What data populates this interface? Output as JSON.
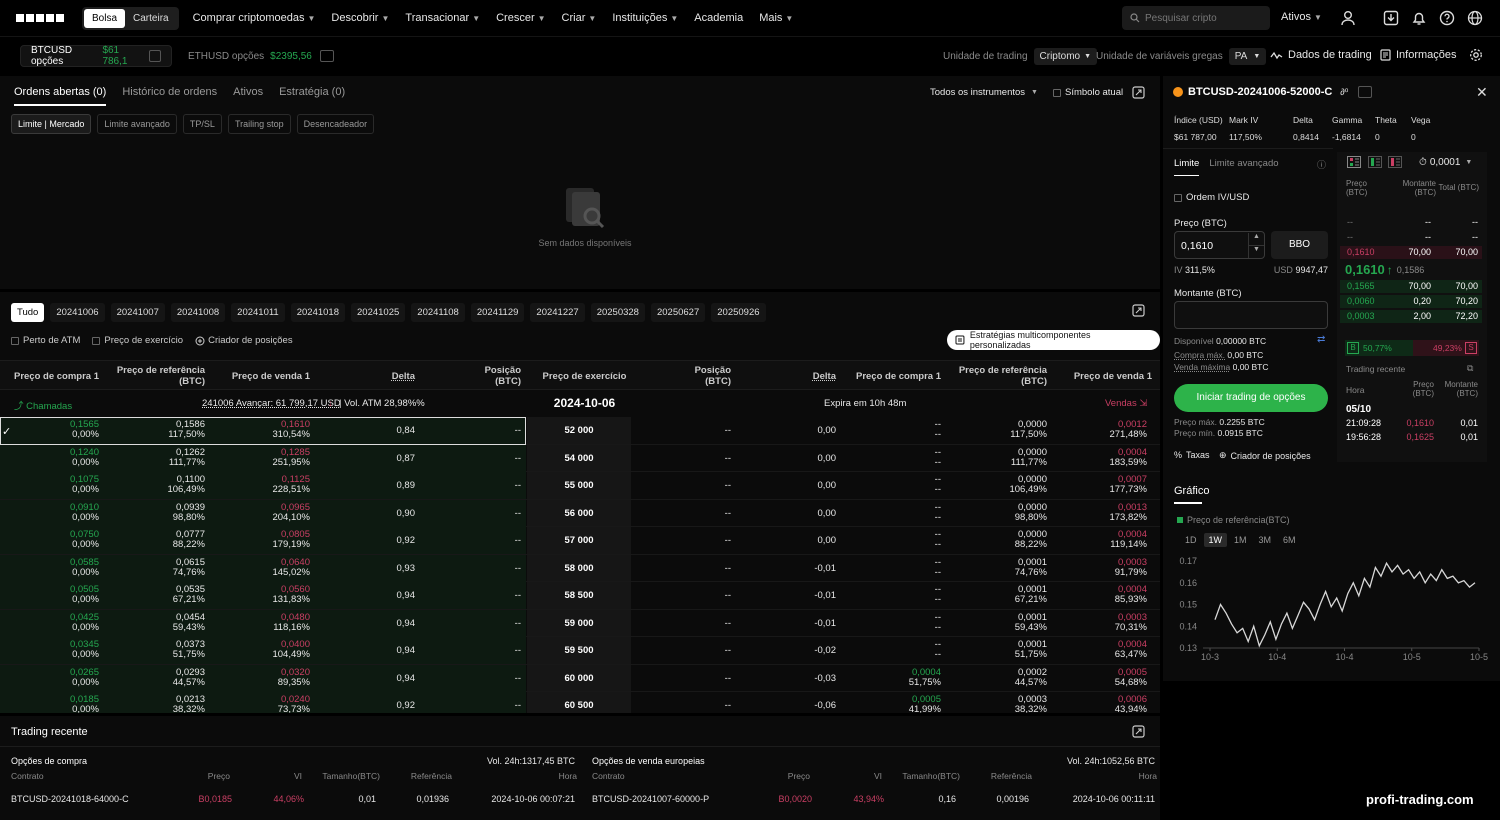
{
  "nav": {
    "mode_tabs": [
      "Bolsa",
      "Carteira"
    ],
    "items": [
      "Comprar criptomoedas",
      "Descobrir",
      "Transacionar",
      "Crescer",
      "Criar",
      "Instituições",
      "Academia",
      "Mais"
    ],
    "search_placeholder": "Pesquisar cripto",
    "assets_label": "Ativos"
  },
  "subbar": {
    "ticker1_name": "BTCUSD opções",
    "ticker1_price": "$61 786,1",
    "ticker2_name": "ETHUSD opções",
    "ticker2_price": "$2395,56",
    "trading_unit_label": "Unidade de trading",
    "trading_unit_value": "Criptomo",
    "greeks_unit_label": "Unidade de variáveis gregas",
    "greeks_unit_value": "PA",
    "trading_data": "Dados de trading",
    "information": "Informações"
  },
  "orders": {
    "tabs": [
      "Ordens abertas (0)",
      "Histórico de ordens",
      "Ativos",
      "Estratégia (0)"
    ],
    "filter_all": "Todos os instrumentos",
    "current_symbol": "Símbolo atual",
    "chips": [
      "Limite | Mercado",
      "Limite avançado",
      "TP/SL",
      "Trailing stop",
      "Desencadeador"
    ],
    "empty": "Sem dados disponíveis"
  },
  "chain": {
    "expiry_tabs": [
      "Tudo",
      "20241006",
      "20241007",
      "20241008",
      "20241011",
      "20241018",
      "20241025",
      "20241108",
      "20241129",
      "20241227",
      "20250328",
      "20250627",
      "20250926"
    ],
    "near_atm": "Perto de ATM",
    "strike_price_opt": "Preço de exercício",
    "position_builder": "Criador de posições",
    "multi_strategies": "Estratégias multicomponentes personalizadas",
    "headers_left": [
      "Preço de compra 1",
      "Preço de referência (BTC)",
      "Preço de venda 1",
      "Delta",
      "Posição (BTC)"
    ],
    "header_strike": "Preço de exercício",
    "headers_right": [
      "Posição (BTC)",
      "Delta",
      "Preço de compra 1",
      "Preço de referência (BTC)",
      "Preço de venda 1"
    ],
    "calls_label": "Chamadas",
    "forward_info": "241006 Avançar: 61 799,17 USD",
    "atm_vol": "Vol. ATM 28,98%%",
    "expiry_date": "2024-10-06",
    "expires_in": "Expira em 10h 48m",
    "puts_label": "Vendas",
    "rows": [
      {
        "cb": "0,1565",
        "cbi": "0,00%",
        "cm": "0,1586",
        "cmi": "117,50%",
        "cs": "0,1610",
        "csi": "310,54%",
        "cd": "0,84",
        "cp": "--",
        "k": "52 000",
        "pp": "--",
        "pd": "0,00",
        "pb": "--",
        "pbi": "--",
        "pm": "0,0000",
        "pmi": "117,50%",
        "ps": "0,0012",
        "psi": "271,48%"
      },
      {
        "cb": "0,1240",
        "cbi": "0,00%",
        "cm": "0,1262",
        "cmi": "111,77%",
        "cs": "0,1285",
        "csi": "251,95%",
        "cd": "0,87",
        "cp": "--",
        "k": "54 000",
        "pp": "--",
        "pd": "0,00",
        "pb": "--",
        "pbi": "--",
        "pm": "0,0000",
        "pmi": "111,77%",
        "ps": "0,0004",
        "psi": "183,59%"
      },
      {
        "cb": "0,1075",
        "cbi": "0,00%",
        "cm": "0,1100",
        "cmi": "106,49%",
        "cs": "0,1125",
        "csi": "228,51%",
        "cd": "0,89",
        "cp": "--",
        "k": "55 000",
        "pp": "--",
        "pd": "0,00",
        "pb": "--",
        "pbi": "--",
        "pm": "0,0000",
        "pmi": "106,49%",
        "ps": "0,0007",
        "psi": "177,73%"
      },
      {
        "cb": "0,0910",
        "cbi": "0,00%",
        "cm": "0,0939",
        "cmi": "98,80%",
        "cs": "0,0965",
        "csi": "204,10%",
        "cd": "0,90",
        "cp": "--",
        "k": "56 000",
        "pp": "--",
        "pd": "0,00",
        "pb": "--",
        "pbi": "--",
        "pm": "0,0000",
        "pmi": "98,80%",
        "ps": "0,0013",
        "psi": "173,82%"
      },
      {
        "cb": "0,0750",
        "cbi": "0,00%",
        "cm": "0,0777",
        "cmi": "88,22%",
        "cs": "0,0805",
        "csi": "179,19%",
        "cd": "0,92",
        "cp": "--",
        "k": "57 000",
        "pp": "--",
        "pd": "0,00",
        "pb": "--",
        "pbi": "--",
        "pm": "0,0000",
        "pmi": "88,22%",
        "ps": "0,0004",
        "psi": "119,14%"
      },
      {
        "cb": "0,0585",
        "cbi": "0,00%",
        "cm": "0,0615",
        "cmi": "74,76%",
        "cs": "0,0640",
        "csi": "145,02%",
        "cd": "0,93",
        "cp": "--",
        "k": "58 000",
        "pp": "--",
        "pd": "-0,01",
        "pb": "--",
        "pbi": "--",
        "pm": "0,0001",
        "pmi": "74,76%",
        "ps": "0,0003",
        "psi": "91,79%"
      },
      {
        "cb": "0,0505",
        "cbi": "0,00%",
        "cm": "0,0535",
        "cmi": "67,21%",
        "cs": "0,0560",
        "csi": "131,83%",
        "cd": "0,94",
        "cp": "--",
        "k": "58 500",
        "pp": "--",
        "pd": "-0,01",
        "pb": "--",
        "pbi": "--",
        "pm": "0,0001",
        "pmi": "67,21%",
        "ps": "0,0004",
        "psi": "85,93%"
      },
      {
        "cb": "0,0425",
        "cbi": "0,00%",
        "cm": "0,0454",
        "cmi": "59,43%",
        "cs": "0,0480",
        "csi": "118,16%",
        "cd": "0,94",
        "cp": "--",
        "k": "59 000",
        "pp": "--",
        "pd": "-0,01",
        "pb": "--",
        "pbi": "--",
        "pm": "0,0001",
        "pmi": "59,43%",
        "ps": "0,0003",
        "psi": "70,31%"
      },
      {
        "cb": "0,0345",
        "cbi": "0,00%",
        "cm": "0,0373",
        "cmi": "51,75%",
        "cs": "0,0400",
        "csi": "104,49%",
        "cd": "0,94",
        "cp": "--",
        "k": "59 500",
        "pp": "--",
        "pd": "-0,02",
        "pb": "--",
        "pbi": "--",
        "pm": "0,0001",
        "pmi": "51,75%",
        "ps": "0,0004",
        "psi": "63,47%"
      },
      {
        "cb": "0,0265",
        "cbi": "0,00%",
        "cm": "0,0293",
        "cmi": "44,57%",
        "cs": "0,0320",
        "csi": "89,35%",
        "cd": "0,94",
        "cp": "--",
        "k": "60 000",
        "pp": "--",
        "pd": "-0,03",
        "pb": "0,0004",
        "pbi": "51,75%",
        "pm": "0,0002",
        "pmi": "44,57%",
        "ps": "0,0005",
        "psi": "54,68%"
      },
      {
        "cb": "0,0185",
        "cbi": "0,00%",
        "cm": "0,0213",
        "cmi": "38,32%",
        "cs": "0,0240",
        "csi": "73,73%",
        "cd": "0,92",
        "cp": "--",
        "k": "60 500",
        "pp": "--",
        "pd": "-0,06",
        "pb": "0,0005",
        "pbi": "41,99%",
        "pm": "0,0003",
        "pmi": "38,32%",
        "ps": "0,0006",
        "psi": "43,94%"
      }
    ]
  },
  "recent": {
    "title": "Trading recente",
    "calls_title": "Opções de compra",
    "calls_vol": "Vol. 24h:1317,45 BTC",
    "puts_title": "Opções de venda europeias",
    "puts_vol": "Vol. 24h:1052,56 BTC",
    "cols": [
      "Contrato",
      "Preço",
      "VI",
      "Tamanho(BTC)",
      "Referência",
      "Hora"
    ],
    "call_trade": {
      "contract": "BTCUSD-20241018-64000-C",
      "price": "B0,0185",
      "iv": "44,06%",
      "size": "0,01",
      "ref": "0,01936",
      "time": "2024-10-06 00:07:21"
    },
    "put_trade": {
      "contract": "BTCUSD-20241007-60000-P",
      "price": "B0,0020",
      "iv": "43,94%",
      "size": "0,16",
      "ref": "0,00196",
      "time": "2024-10-06 00:11:11"
    }
  },
  "side": {
    "instrument": "BTCUSD-20241006-52000-C",
    "stats_labels": [
      "Índice (USD)",
      "Mark IV",
      "Delta",
      "Gamma",
      "Theta",
      "Vega"
    ],
    "stats_values": [
      "$61 787,00",
      "117,50%",
      "0,8414",
      "-1,6814",
      "0",
      "0"
    ],
    "order_tabs": [
      "Limite",
      "Limite avançado"
    ],
    "iv_order": "Ordem IV/USD",
    "price_label": "Preço (BTC)",
    "price_value": "0,1610",
    "bbo": "BBO",
    "iv_label": "IV",
    "iv_value": "311,5%",
    "usd_label": "USD",
    "usd_value": "9947,47",
    "amount_label": "Montante (BTC)",
    "available_label": "Disponível",
    "available_value": "0,00000 BTC",
    "max_buy_label": "Compra máx.",
    "max_buy_value": "0,00 BTC",
    "max_sell_label": "Venda máxima",
    "max_sell_value": "0,00 BTC",
    "start_button": "Iniciar trading de opções",
    "max_price_label": "Preço máx.",
    "max_price_value": "0.2255 BTC",
    "min_price_label": "Preço mín.",
    "min_price_value": "0.0915 BTC",
    "fees": "Taxas",
    "position_builder": "Criador de posições",
    "tick_size": "0,0001",
    "book_headers": [
      "Preço (BTC)",
      "Montante (BTC)",
      "Total (BTC)"
    ],
    "asks": [
      {
        "p": "--",
        "a": "--",
        "t": "--"
      },
      {
        "p": "--",
        "a": "--",
        "t": "--"
      },
      {
        "p": "0,1610",
        "a": "70,00",
        "t": "70,00"
      }
    ],
    "last_price": "0,1610",
    "last_mark": "0,1586",
    "bids": [
      {
        "p": "0,1565",
        "a": "70,00",
        "t": "70,00"
      },
      {
        "p": "0,0060",
        "a": "0,20",
        "t": "70,20"
      },
      {
        "p": "0,0003",
        "a": "2,00",
        "t": "72,20"
      }
    ],
    "buy_ratio_label": "B",
    "buy_ratio": "50,77%",
    "sell_ratio": "49,23%",
    "sell_ratio_label": "S",
    "recent_title": "Trading recente",
    "recent_headers": [
      "Hora",
      "Preço (BTC)",
      "Montante (BTC)"
    ],
    "recent_date": "05/10",
    "recent_trades": [
      {
        "t": "21:09:28",
        "p": "0,1610",
        "a": "0,01"
      },
      {
        "t": "19:56:28",
        "p": "0,1625",
        "a": "0,01"
      }
    ],
    "chart_title": "Gráfico",
    "chart_legend": "Preço de referência(BTC)",
    "ranges": [
      "1D",
      "1W",
      "1M",
      "3M",
      "6M"
    ],
    "active_range": "1W"
  },
  "chart_data": {
    "type": "line",
    "series": [
      {
        "name": "Preço de referência(BTC)",
        "values": [
          0.143,
          0.15,
          0.146,
          0.141,
          0.137,
          0.139,
          0.133,
          0.14,
          0.131,
          0.136,
          0.142,
          0.134,
          0.141,
          0.146,
          0.139,
          0.145,
          0.151,
          0.148,
          0.143,
          0.15,
          0.156,
          0.149,
          0.153,
          0.147,
          0.155,
          0.16,
          0.154,
          0.162,
          0.158,
          0.167,
          0.163,
          0.169,
          0.165,
          0.168,
          0.164,
          0.166,
          0.162,
          0.165,
          0.16,
          0.164,
          0.161,
          0.166,
          0.162,
          0.163,
          0.16,
          0.161,
          0.158,
          0.16
        ]
      }
    ],
    "x_tick_labels": [
      "10-3",
      "10-4",
      "10-4",
      "10-5",
      "10-5"
    ],
    "yticks": [
      0.13,
      0.14,
      0.15,
      0.16,
      0.17
    ],
    "ylim": [
      0.13,
      0.17
    ]
  },
  "watermark": "profi-trading.com",
  "colors": {
    "accent_green": "#25a750",
    "accent_red": "#ca3f64",
    "button_green": "#2db34a"
  }
}
